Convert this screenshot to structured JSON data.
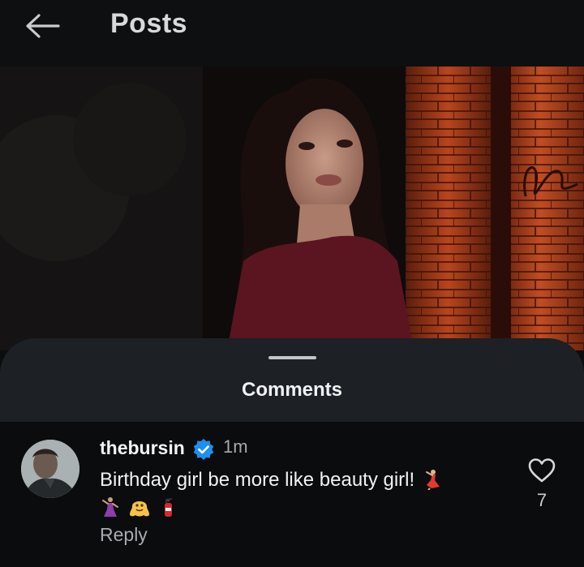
{
  "header": {
    "title": "Posts",
    "back_icon": "arrow-left-icon"
  },
  "sheet": {
    "title": "Comments"
  },
  "comment": {
    "username": "thebursin",
    "verified": true,
    "time": "1m",
    "text": "Birthday girl be more like beauty girl!",
    "emojis_inline": [
      "dancer-emoji"
    ],
    "emojis_second_line": [
      "woman-dancing-emoji",
      "melting-face-emoji",
      "fire-extinguisher-emoji"
    ],
    "reply_label": "Reply",
    "like_count": "7"
  },
  "colors": {
    "background": "#0c0d0f",
    "sheet": "#1d2024",
    "verified_badge": "#1d8ff0",
    "brick_orange": "#b9461f"
  }
}
